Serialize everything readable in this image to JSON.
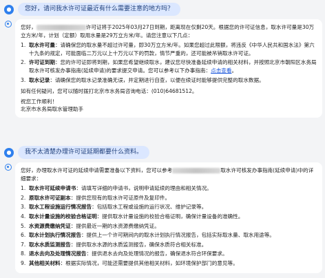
{
  "conversation": {
    "q1": "您好，请问我水许可证最近有什么需要注意的地方吗？",
    "a1": {
      "intro_pre": "您好，",
      "intro_post": "许可证将于2025年03月27日到期，距离现在仅剩20天。根据您的许可证信息，取水许可量是30万立方米/年，计划（定额）取用水量是29万立方米/年。请您注意以下几点：",
      "items": [
        {
          "num": "1.",
          "title": "取水许可量",
          "text": "：请确保您的取水量不超过许可量，即30万立方米/年。如果您超过此限额，将违反《中华人民共和国水法》第六十九条的规定，可能面临二万元以上十万元以下的罚款，情节严重的，还可能被吊销取水许可证。"
        },
        {
          "num": "2.",
          "title": "许可证到期",
          "text": "：您的许可证即将到期，如果您希望继续取水，建议您尽快准备延续申请的相关材料，并按照北京市朝阳区水务局取水许可核发办事指南(延续申请)的要求提交申请。您可以参考以下办事指南：",
          "link": "点击查看",
          "after": "。"
        },
        {
          "num": "3.",
          "title": "取水记录",
          "text": "：请确保您的取水记录准确无误，并定期进行自查，以便在续证时能够提供完整的取水数据。"
        }
      ],
      "closing": "如有任何疑问，您可以随时拨打北京市水务局咨询电话：(010)64681512。",
      "wish": "祝您工作顺利！",
      "sign": "北京市水务局取水管理助手"
    },
    "q2": "我不太清楚办理许可证延期都要什么资料。",
    "a2": {
      "intro_pre": "您好，办理取水许可证的延续申请需要准备以下资料，您可以参考",
      "intro_post": "取水许可核发办事指南(延续申请)中的详细要求：",
      "items": [
        {
          "num": "1.",
          "title": "取水许可延续申请书",
          "text": "：请填写详细的申请书，说明申请延续的理由和相关情况。"
        },
        {
          "num": "2.",
          "title": "原取水许可证副本",
          "text": "：提供您现有的取水许可证原件及复印件。"
        },
        {
          "num": "3.",
          "title": "取水工程设施运行情况报告",
          "text": "：包括取水工程或设施的运行状况、维护记录等。"
        },
        {
          "num": "4.",
          "title": "取水计量设施的校验合格证明",
          "text": "：提供取水计量设施的校验合格证明，确保计量设备的准确性。"
        },
        {
          "num": "5.",
          "title": "水资源费缴纳凭证",
          "text": "：提供最近一期的水资源费缴纳凭证。"
        },
        {
          "num": "6.",
          "title": "取水计划执行情况报告",
          "text": "：提供上一个许可期间内的取水计划执行情况报告，包括实际取水量、取水用途等。"
        },
        {
          "num": "7.",
          "title": "取水水质监测报告",
          "text": "：提供取水水源的水质监测报告，确保水质符合相关标准。"
        },
        {
          "num": "8.",
          "title": "退水去向及处理情况报告",
          "text": "：提供退水去向及处理情况的报告，确保退水符合环保要求。"
        },
        {
          "num": "9.",
          "title": "其他相关材料",
          "text": "：根据实际情况，可能还需要提供其他相关材料，如环境保护部门的意见等。"
        }
      ]
    }
  },
  "colors": {
    "accent": "#2f80ed",
    "user_bubble": "#dbe7ff",
    "link": "#1a56db"
  },
  "icons": {
    "user_avatar": "user-avatar-icon",
    "assistant": "assistant-icon"
  }
}
